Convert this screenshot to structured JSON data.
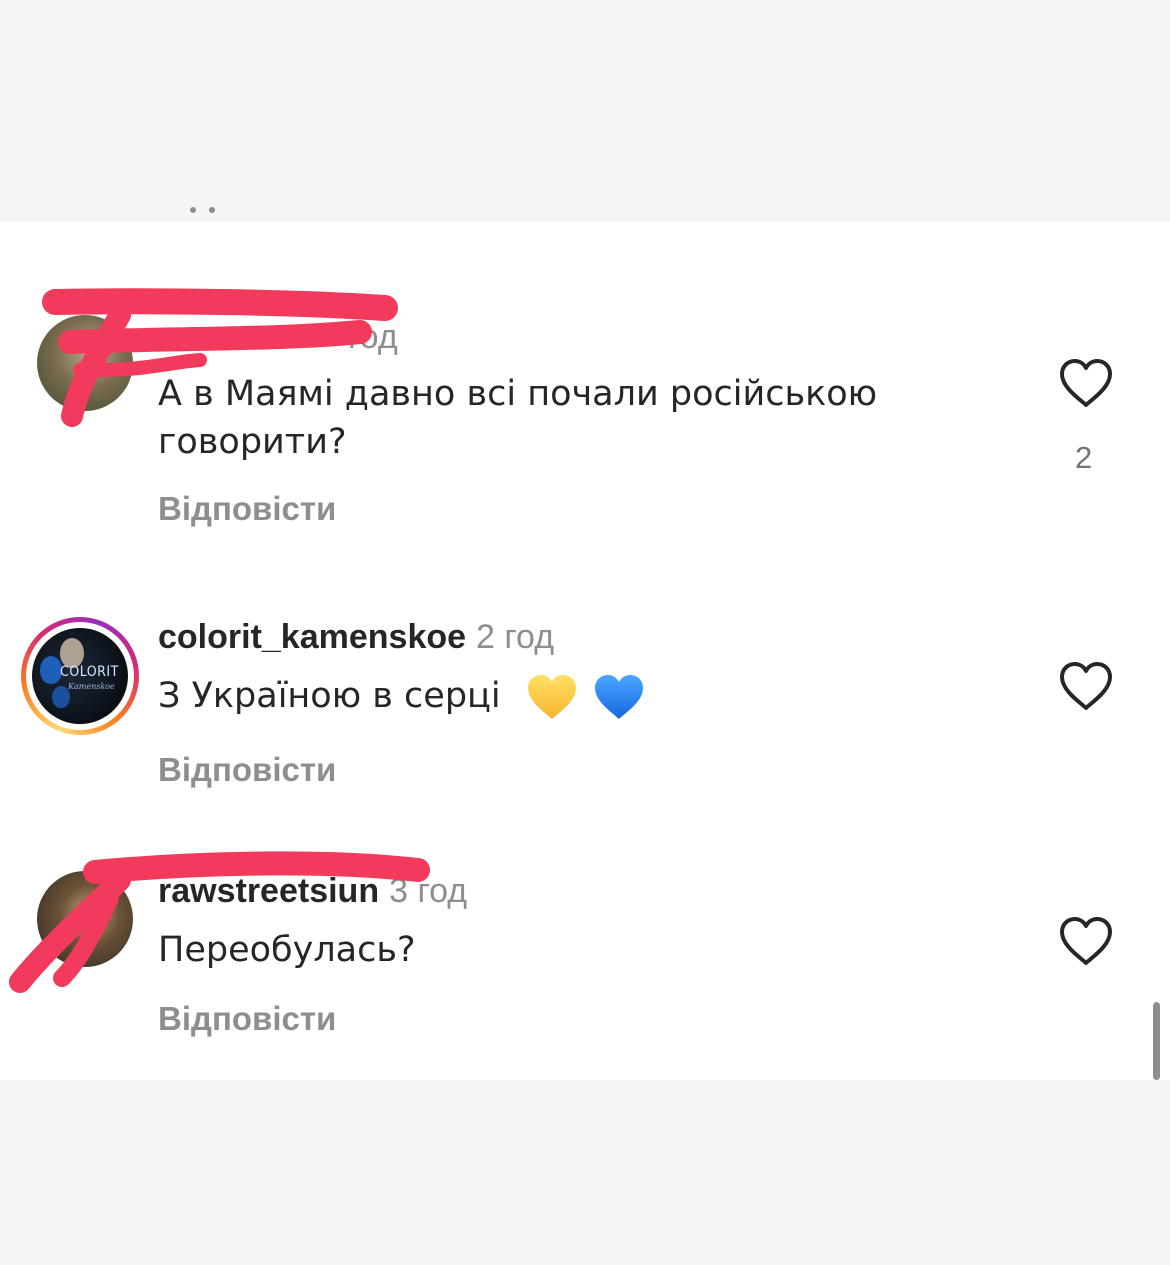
{
  "comments": [
    {
      "username": "",
      "time": "год",
      "text_line1": "А в Маямі давно всі почали російською",
      "text_line2": "говорити?",
      "reply_label": "Відповісти",
      "likes": "2",
      "avatar": "user-avatar-redacted",
      "redacted": true
    },
    {
      "username": "colorit_kamenskoe",
      "time": "2 год",
      "text": "З Україною в серці",
      "emojis": [
        "yellow-heart-emoji",
        "blue-heart-emoji"
      ],
      "reply_label": "Відповісти",
      "avatar": "colorit-story-avatar",
      "story_ring": true
    },
    {
      "username": "rawstreetsiun",
      "time": "3 год",
      "text": "Переобулась?",
      "reply_label": "Відповісти",
      "avatar": "user-avatar-redacted",
      "redacted": true
    }
  ],
  "avatar_text": {
    "brand": "COLORIT",
    "script": "Kamenskoe"
  },
  "icons": {
    "like": "heart-outline-icon"
  },
  "colors": {
    "text": "#262626",
    "secondary": "#8e8e8e",
    "redaction": "#f23b5c",
    "yellow_heart": "#ffc83d",
    "blue_heart": "#1e7df0"
  }
}
